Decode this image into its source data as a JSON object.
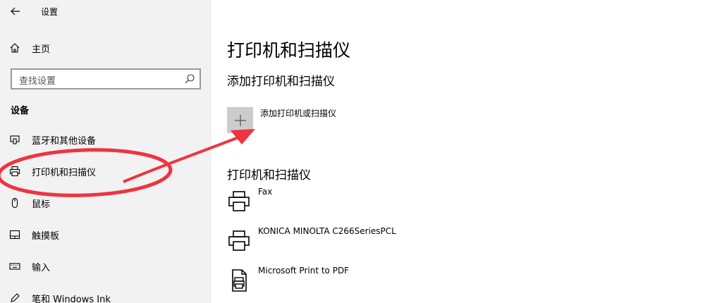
{
  "titlebar": {
    "title": "设置"
  },
  "sidebar": {
    "home_label": "主页",
    "search_placeholder": "查找设置",
    "section": "设备",
    "items": [
      {
        "label": "蓝牙和其他设备",
        "icon": "bluetooth-devices-icon"
      },
      {
        "label": "打印机和扫描仪",
        "icon": "printer-icon"
      },
      {
        "label": "鼠标",
        "icon": "mouse-icon"
      },
      {
        "label": "触摸板",
        "icon": "touchpad-icon"
      },
      {
        "label": "输入",
        "icon": "keyboard-icon"
      },
      {
        "label": "笔和 Windows Ink",
        "icon": "pen-icon"
      }
    ]
  },
  "main": {
    "title": "打印机和扫描仪",
    "add_section": {
      "heading": "添加打印机和扫描仪",
      "button_label": "添加打印机或扫描仪"
    },
    "list_section": {
      "heading": "打印机和扫描仪",
      "printers": [
        {
          "name": "Fax",
          "icon": "printer-icon"
        },
        {
          "name": "KONICA MINOLTA C266SeriesPCL",
          "icon": "printer-icon"
        },
        {
          "name": "Microsoft Print to PDF",
          "icon": "pdf-printer-icon"
        }
      ]
    }
  },
  "annotation": {
    "color": "#ef3340"
  }
}
